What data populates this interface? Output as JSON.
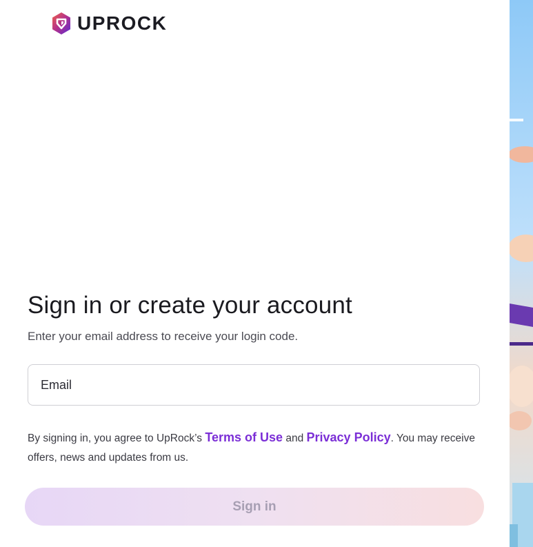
{
  "brand": {
    "name": "UPROCK",
    "logo_icon": "uprock-logo-icon"
  },
  "colors": {
    "accent": "#7b2ed6",
    "button_gradient": [
      "#e7d7f6",
      "#f8dfe0"
    ]
  },
  "auth": {
    "title": "Sign in or create your account",
    "subtitle": "Enter your email address to receive your login code.",
    "email_placeholder": "Email",
    "email_value": "",
    "legal_prefix": "By signing in, you agree to UpRock’s ",
    "terms_link": "Terms of Use",
    "legal_and": " and ",
    "privacy_link": "Privacy Policy",
    "legal_suffix": ". You may receive offers, news and updates from us.",
    "signin_label": "Sign in"
  }
}
